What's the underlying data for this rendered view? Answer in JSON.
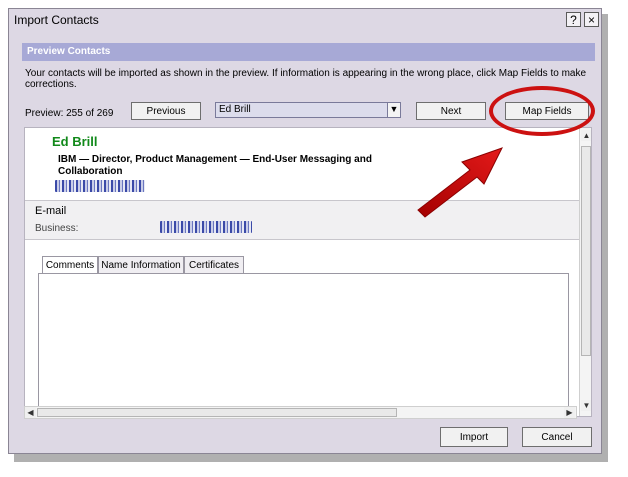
{
  "window": {
    "title": "Import Contacts",
    "help_label": "?",
    "close_label": "×"
  },
  "section": {
    "title": "Preview Contacts"
  },
  "instruction": "Your contacts will be imported as shown in the preview. If information is appearing in the wrong place, click Map Fields to make corrections.",
  "preview": {
    "count_text": "Preview: 255 of 269"
  },
  "buttons": {
    "previous": "Previous",
    "next": "Next",
    "map_fields": "Map Fields",
    "import": "Import",
    "cancel": "Cancel"
  },
  "contact_select": {
    "value": "Ed Brill"
  },
  "contact": {
    "name": "Ed Brill",
    "company": "IBM",
    "title_line": "IBM  —  Director, Product Management — End-User Messaging and Collaboration"
  },
  "email": {
    "section_label": "E-mail",
    "business_label": "Business:"
  },
  "tabs": [
    "Comments",
    "Name Information",
    "Certificates"
  ],
  "colors": {
    "annotation": "#cc1111",
    "name_green": "#11891a",
    "header_bar": "#a7a9d6"
  },
  "icons": {
    "combo": "chevron-down-icon",
    "annotation": "red-arrow-icon"
  }
}
